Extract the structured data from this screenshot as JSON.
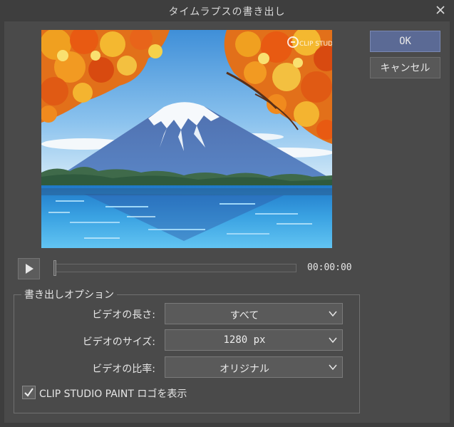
{
  "window": {
    "title": "タイムラプスの書き出し",
    "close_icon": "close-icon"
  },
  "buttons": {
    "ok": "OK",
    "cancel": "キャンセル"
  },
  "playback": {
    "play_icon": "play-icon",
    "time": "00:00:00",
    "progress": 0
  },
  "options": {
    "legend": "書き出しオプション",
    "length_label": "ビデオの長さ:",
    "length_value": "すべて",
    "size_label": "ビデオのサイズ:",
    "size_value": "1280 px",
    "ratio_label": "ビデオの比率:",
    "ratio_value": "オリジナル",
    "logo_checkbox_label": "CLIP STUDIO PAINT ロゴを表示",
    "logo_checked": true
  },
  "preview": {
    "watermark": "CLIP STUDIO PAINT"
  },
  "colors": {
    "ok_button": "#5b6a95",
    "panel": "#4a4a4a",
    "background": "#3e3e3e"
  }
}
